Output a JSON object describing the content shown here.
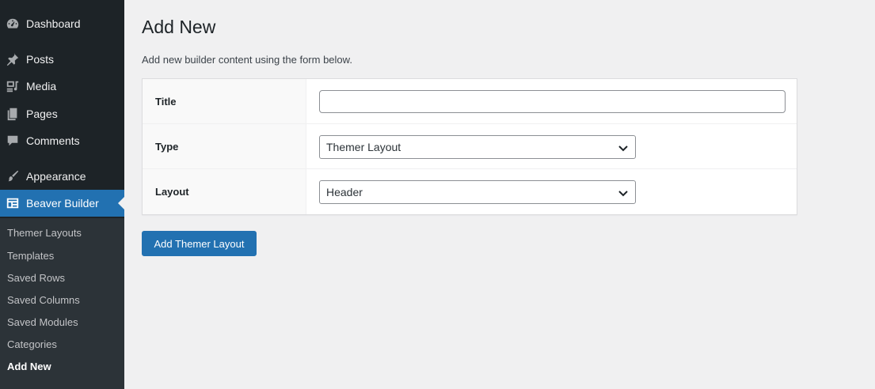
{
  "sidebar": {
    "items": [
      {
        "label": "Dashboard",
        "icon": "dashboard-icon"
      },
      {
        "label": "Posts",
        "icon": "pin-icon"
      },
      {
        "label": "Media",
        "icon": "media-icon"
      },
      {
        "label": "Pages",
        "icon": "pages-icon"
      },
      {
        "label": "Comments",
        "icon": "comment-icon"
      },
      {
        "label": "Appearance",
        "icon": "brush-icon"
      },
      {
        "label": "Beaver Builder",
        "icon": "layout-icon",
        "active": true
      }
    ],
    "submenu": [
      {
        "label": "Themer Layouts"
      },
      {
        "label": "Templates"
      },
      {
        "label": "Saved Rows"
      },
      {
        "label": "Saved Columns"
      },
      {
        "label": "Saved Modules"
      },
      {
        "label": "Categories"
      },
      {
        "label": "Add New",
        "current": true
      }
    ]
  },
  "main": {
    "title": "Add New",
    "description": "Add new builder content using the form below.",
    "form": {
      "title_label": "Title",
      "title_value": "",
      "type_label": "Type",
      "type_value": "Themer Layout",
      "layout_label": "Layout",
      "layout_value": "Header"
    },
    "submit_label": "Add Themer Layout"
  },
  "colors": {
    "sidebar_bg": "#1d2327",
    "submenu_bg": "#2c3338",
    "accent": "#2271b1",
    "page_bg": "#f0f0f1"
  }
}
